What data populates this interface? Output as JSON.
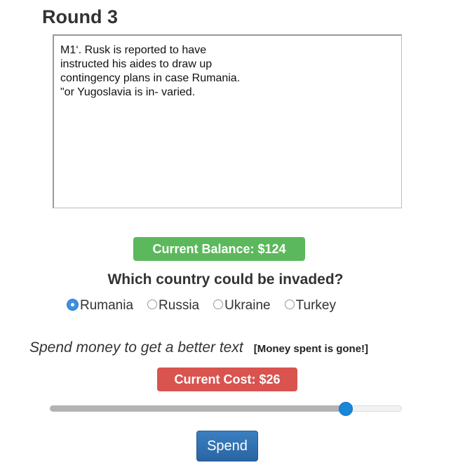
{
  "round": {
    "title": "Round 3"
  },
  "text_area": {
    "content": "M1‘. Rusk is reported to have\ninstructed his aides to draw up\ncontingency plans in case Rumania.\n\"or Yugoslavia is in- varied."
  },
  "balance": {
    "label": "Current Balance: $124",
    "color": "#5cb85c"
  },
  "question": {
    "text": "Which country could be invaded?",
    "options": [
      {
        "label": "Rumania",
        "selected": true
      },
      {
        "label": "Russia",
        "selected": false
      },
      {
        "label": "Ukraine",
        "selected": false
      },
      {
        "label": "Turkey",
        "selected": false
      }
    ]
  },
  "spend": {
    "prompt": "Spend money to get a better text",
    "note": "[Money spent is gone!]",
    "cost_label": "Current Cost: $26",
    "cost_color": "#d9534f",
    "slider_fraction": 0.84,
    "button_label": "Spend"
  }
}
